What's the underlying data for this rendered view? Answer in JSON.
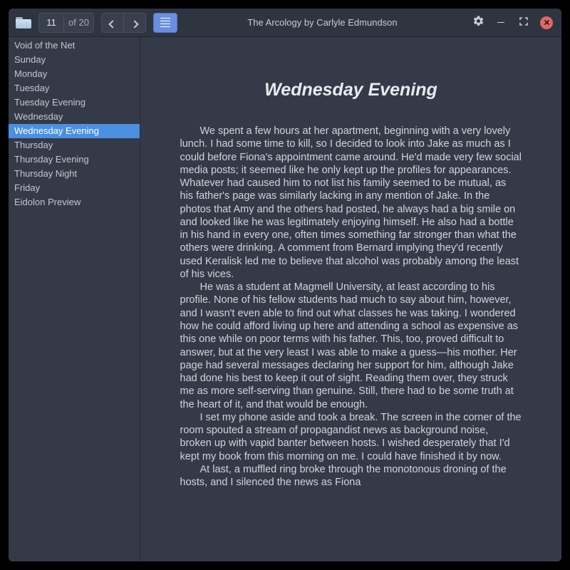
{
  "toolbar": {
    "page_current": "11",
    "page_total": "of 20",
    "title": "The Arcology by Carlyle Edmundson"
  },
  "sidebar": {
    "items": [
      "Void of the Net",
      "Sunday",
      "Monday",
      "Tuesday",
      "Tuesday Evening",
      "Wednesday",
      "Wednesday Evening",
      "Thursday",
      "Thursday Evening",
      "Thursday Night",
      "Friday",
      "Eidolon Preview"
    ],
    "selected_index": 6
  },
  "document": {
    "chapter_title": "Wednesday Evening",
    "paragraphs": [
      "We spent a few hours at her apartment, beginning with a very lovely lunch. I had some time to kill, so I decided to look into Jake as much as I could before Fiona's appointment came around. He'd made very few social media posts; it seemed like he only kept up the profiles for appearances. Whatever had caused him to not list his family seemed to be mutual, as his father's page was similarly lacking in any mention of Jake. In the photos that Amy and the others had posted, he always had a big smile on and looked like he was legitimately enjoying himself. He also had a bottle in his hand in every one, often times something far stronger than what the others were drinking. A comment from Bernard implying they'd recently used Keralisk led me to believe that alcohol was probably among the least of his vices.",
      "He was a student at Magmell University, at least according to his profile. None of his fellow students had much to say about him, however, and I wasn't even able to find out what classes he was taking. I wondered how he could afford living up here and attending a school as expensive as this one while on poor terms with his father. This, too, proved difficult to answer, but at the very least I was able to make a guess—his mother. Her page had several messages declaring her support for him, although Jake had done his best to keep it out of sight. Reading them over, they struck me as more self-serving than genuine. Still, there had to be some truth at the heart of it, and that would be enough.",
      "I set my phone aside and took a break. The screen in the corner of the room spouted a stream of propagandist news as background noise, broken up with vapid banter between hosts. I wished desperately that I'd kept my book from this morning on me. I could have finished it by now.",
      "At last, a muffled ring broke through the monotonous droning of the hosts, and I silenced the news as Fiona"
    ]
  }
}
